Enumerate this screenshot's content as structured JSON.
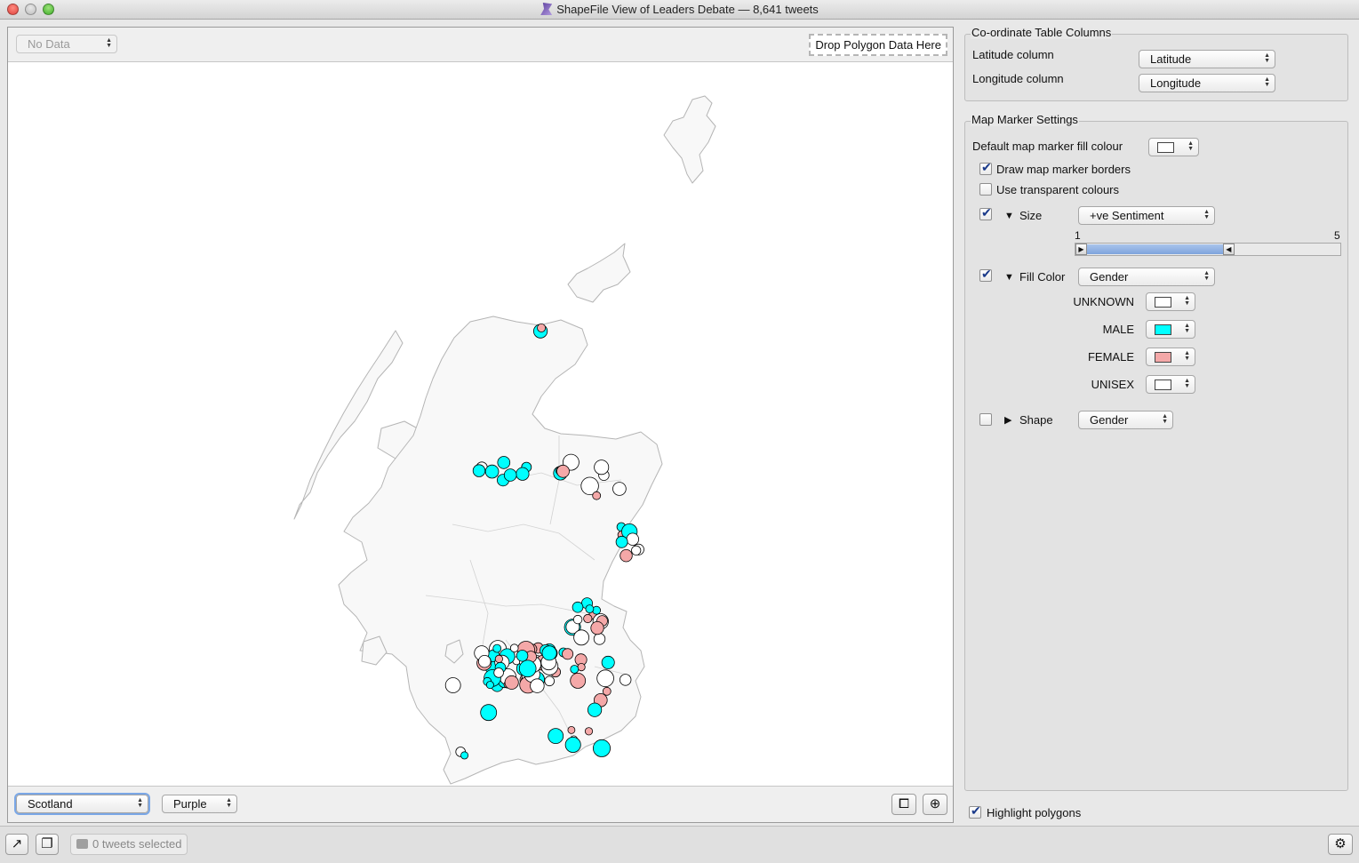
{
  "window": {
    "title": "ShapeFile View of Leaders Debate — 8,641 tweets"
  },
  "map_toolbar": {
    "data_popup": "No Data",
    "drop_zone": "Drop Polygon Data Here"
  },
  "map_bottom": {
    "region_popup": "Scotland",
    "colour_popup": "Purple"
  },
  "coords": {
    "section_title": "Co-ordinate Table Columns",
    "lat_label": "Latitude column",
    "lat_value": "Latitude",
    "lon_label": "Longitude column",
    "lon_value": "Longitude"
  },
  "marker": {
    "section_title": "Map Marker Settings",
    "default_fill_label": "Default map marker fill colour",
    "default_fill_colour": "#ffffff",
    "draw_borders_label": "Draw map marker borders",
    "draw_borders": true,
    "transparent_label": "Use transparent colours",
    "transparent": false,
    "size": {
      "enabled": true,
      "label": "Size",
      "value": "+ve Sentiment",
      "min_label": "1",
      "max_label": "5",
      "range": [
        1,
        3.4
      ]
    },
    "fill": {
      "enabled": true,
      "label": "Fill Color",
      "value": "Gender",
      "items": [
        {
          "label": "UNKNOWN",
          "colour": "#ffffff"
        },
        {
          "label": "MALE",
          "colour": "#00ffff"
        },
        {
          "label": "FEMALE",
          "colour": "#f4a8a8"
        },
        {
          "label": "UNISEX",
          "colour": "#ffffff"
        }
      ]
    },
    "shape": {
      "enabled": false,
      "label": "Shape",
      "value": "Gender"
    }
  },
  "highlight": {
    "label": "Highlight polygons",
    "checked": true
  },
  "status": {
    "selection": "0 tweets selected"
  },
  "colors": {
    "male": "#00ffff",
    "female": "#f4a8a8",
    "unknown": "#ffffff",
    "land": "#f8f8f8",
    "coast": "#b5b5b5"
  }
}
